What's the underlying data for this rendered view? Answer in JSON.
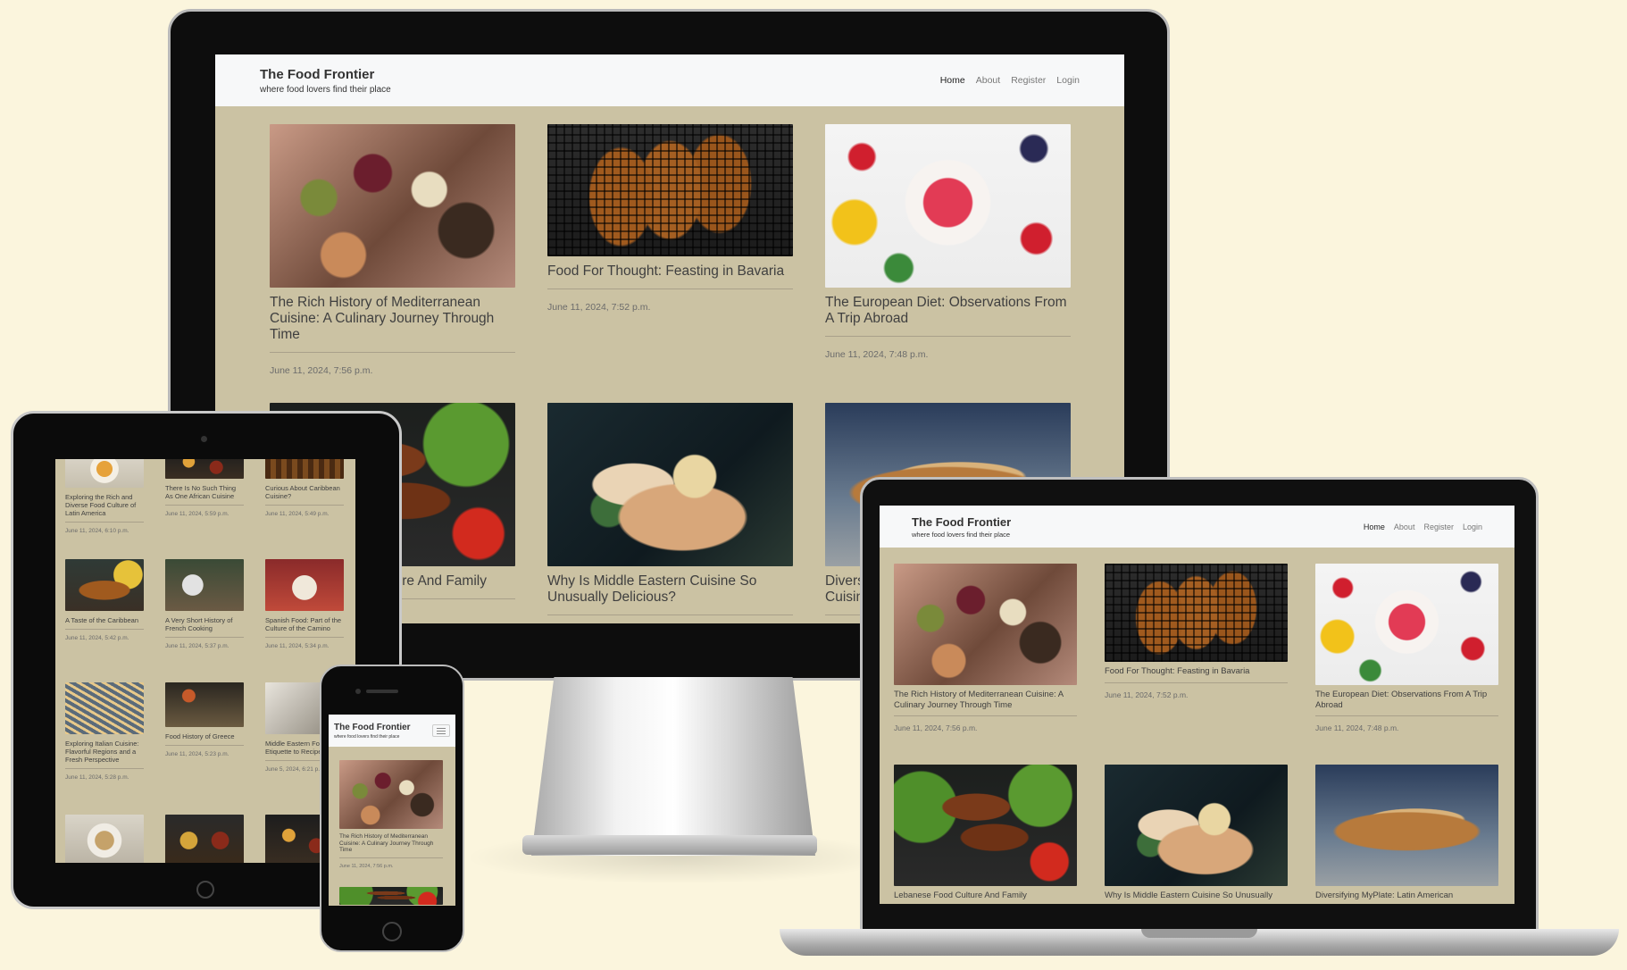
{
  "site": {
    "title": "The Food Frontier",
    "tagline": "where food lovers find their place",
    "nav": [
      "Home",
      "About",
      "Register",
      "Login"
    ]
  },
  "monitor_posts": [
    {
      "title": "The Rich History of Mediterranean Cuisine: A Culinary Journey Through Time",
      "date": "June 11, 2024, 7:56 p.m.",
      "img": "img-med"
    },
    {
      "title": "Food For Thought: Feasting in Bavaria",
      "date": "June 11, 2024, 7:52 p.m.",
      "img": "img-pretzel"
    },
    {
      "title": "The European Diet: Observations From A Trip Abroad",
      "date": "June 11, 2024, 7:48 p.m.",
      "img": "img-bowl"
    },
    {
      "title": "Lebanese Food Culture And Family",
      "date": "",
      "img": "img-kofta"
    },
    {
      "title": "Why Is Middle Eastern Cuisine So Unusually Delicious?",
      "date": "",
      "img": "img-hummus"
    },
    {
      "title": "Diversifying MyPlate: Latin American Cuisine",
      "date": "",
      "img": "img-quesa"
    }
  ],
  "laptop_posts": [
    {
      "title": "The Rich History of Mediterranean Cuisine: A Culinary Journey Through Time",
      "date": "June 11, 2024, 7:56 p.m.",
      "img": "img-med"
    },
    {
      "title": "Food For Thought: Feasting in Bavaria",
      "date": "June 11, 2024, 7:52 p.m.",
      "img": "img-pretzel"
    },
    {
      "title": "The European Diet: Observations From A Trip Abroad",
      "date": "June 11, 2024, 7:48 p.m.",
      "img": "img-bowl"
    },
    {
      "title": "Lebanese Food Culture And Family",
      "date": "",
      "img": "img-kofta"
    },
    {
      "title": "Why Is Middle Eastern Cuisine So Unusually",
      "date": "",
      "img": "img-hummus"
    },
    {
      "title": "Diversifying MyPlate: Latin American",
      "date": "",
      "img": "img-quesa"
    }
  ],
  "tablet_posts": [
    {
      "title": "Exploring the Rich and Diverse Food Culture of Latin America",
      "date": "June 11, 2024, 6:10 p.m.",
      "img": "img-latin"
    },
    {
      "title": "There Is No Such Thing As One African Cuisine",
      "date": "June 11, 2024, 5:59 p.m.",
      "img": "img-table"
    },
    {
      "title": "Curious About Caribbean Cuisine?",
      "date": "June 11, 2024, 5:49 p.m.",
      "img": "img-bbq"
    },
    {
      "title": "A Taste of the Caribbean",
      "date": "June 11, 2024, 5:42 p.m.",
      "img": "img-carib"
    },
    {
      "title": "A Very Short History of French Cooking",
      "date": "June 11, 2024, 5:37 p.m.",
      "img": "img-france"
    },
    {
      "title": "Spanish Food: Part of the Culture of the Camino",
      "date": "June 11, 2024, 5:34 p.m.",
      "img": "img-spain"
    },
    {
      "title": "Exploring Italian Cuisine: Flavorful Regions and a Fresh Perspective",
      "date": "June 11, 2024, 5:28 p.m.",
      "img": "img-pasta"
    },
    {
      "title": "Food History of Greece",
      "date": "June 11, 2024, 5:23 p.m.",
      "img": "img-greek"
    },
    {
      "title": "Middle Eastern Food from Etiquette to Recipes",
      "date": "June 5, 2024, 6:21 p.m.",
      "img": "img-eti"
    },
    {
      "title": "",
      "date": "",
      "img": "img-plate"
    },
    {
      "title": "",
      "date": "",
      "img": "img-mix"
    },
    {
      "title": "",
      "date": "",
      "img": "img-table"
    }
  ],
  "phone_post": {
    "title": "The Rich History of Mediterranean Cuisine: A Culinary Journey Through Time",
    "date": "June 11, 2024, 7:56 p.m."
  },
  "colors": {
    "page_bg": "#fbf5dd",
    "content_bg": "#cbc2a3",
    "nav_bg": "#f7f8f9"
  }
}
